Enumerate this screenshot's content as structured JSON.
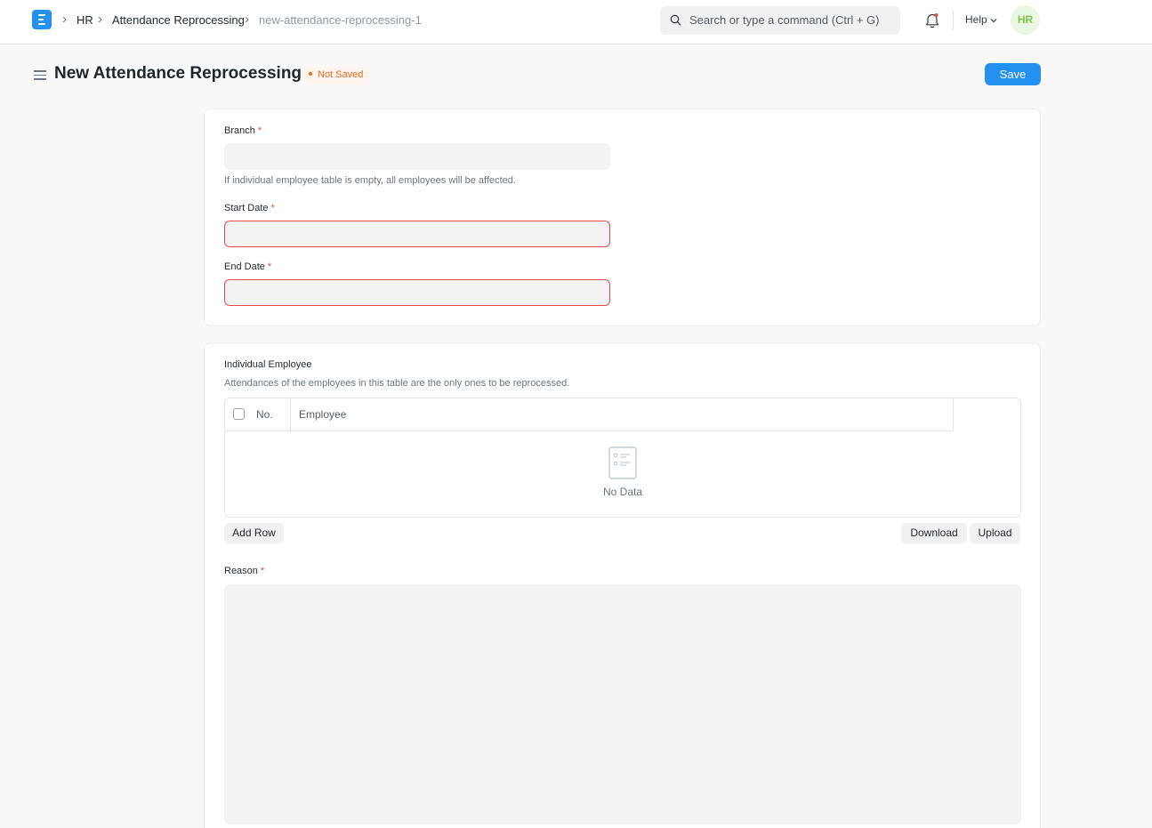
{
  "navbar": {
    "breadcrumbs": [
      "HR",
      "Attendance Reprocessing",
      "new-attendance-reprocessing-1"
    ],
    "search_placeholder": "Search or type a command (Ctrl + G)",
    "help_label": "Help",
    "avatar_initials": "HR"
  },
  "page": {
    "title": "New Attendance Reprocessing",
    "status": "Not Saved",
    "save_label": "Save"
  },
  "form": {
    "branch_label": "Branch",
    "branch_value": "",
    "branch_desc": "If individual employee table is empty, all employees will be affected.",
    "start_date_label": "Start Date",
    "start_date_value": "",
    "end_date_label": "End Date",
    "end_date_value": "",
    "required_mark": "*"
  },
  "employee_table": {
    "label": "Individual Employee",
    "description": "Attendances of the employees in this table are the only ones to be reprocessed.",
    "col_no": "No.",
    "col_employee": "Employee",
    "empty_text": "No Data",
    "add_row_label": "Add Row",
    "download_label": "Download",
    "upload_label": "Upload"
  },
  "reason": {
    "label": "Reason",
    "value": ""
  },
  "colors": {
    "primary": "#2490ef",
    "error": "#e24c4c",
    "indicator": "#e86c13"
  }
}
